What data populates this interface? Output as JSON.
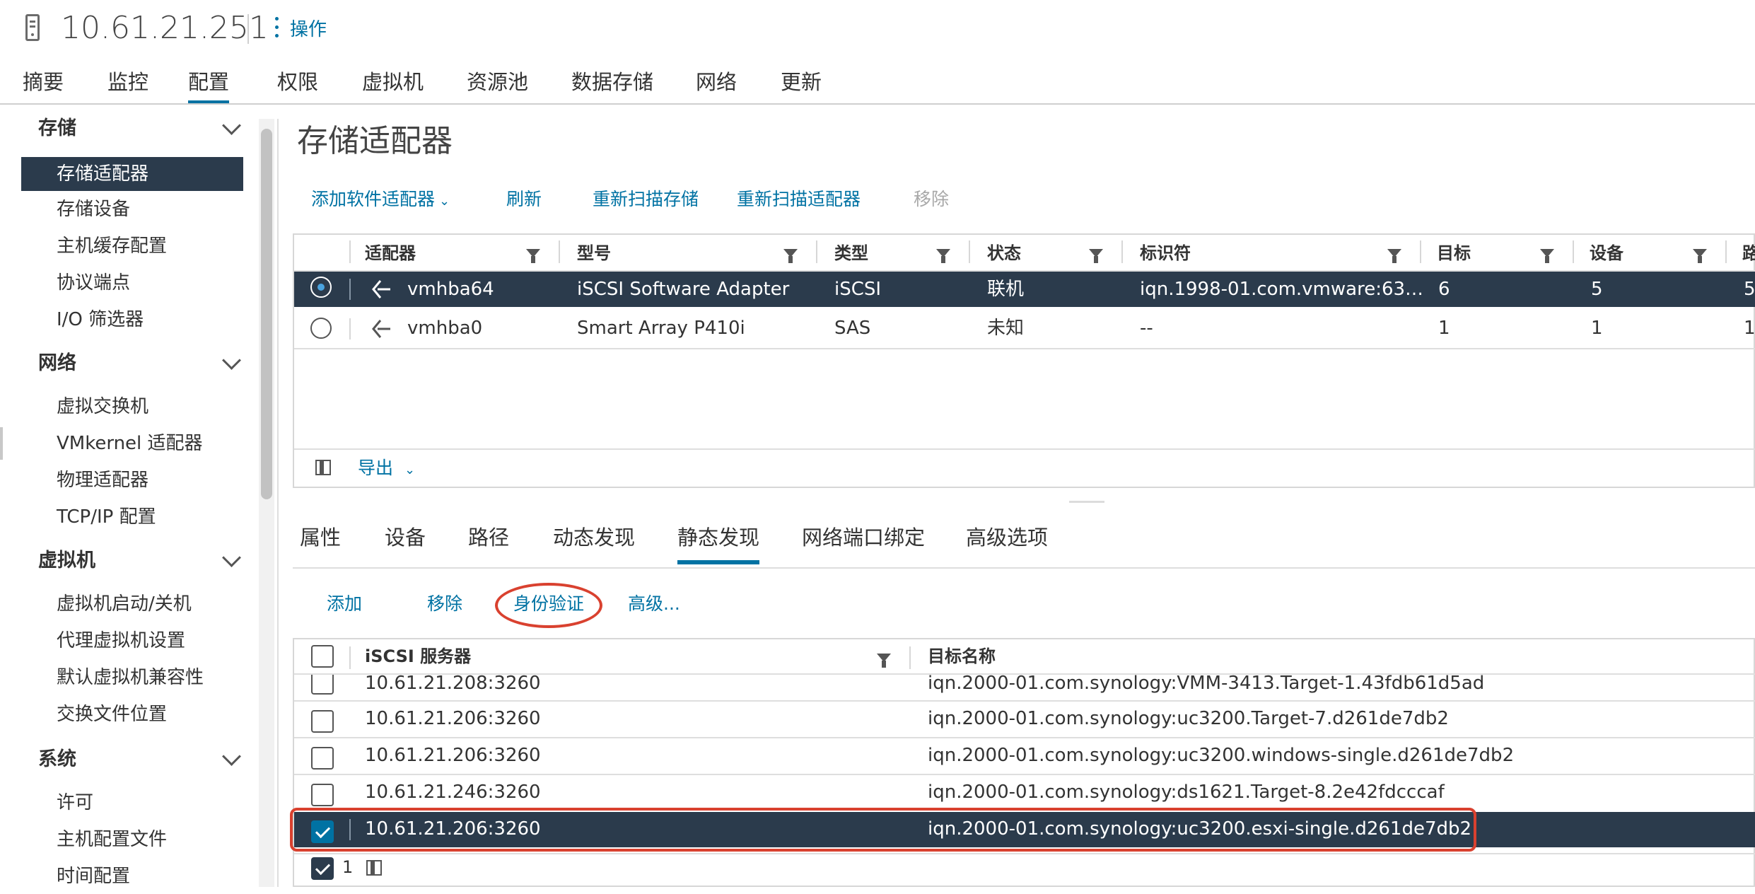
{
  "header": {
    "host": "10.61.21.251",
    "actions_label": "操作"
  },
  "top_tabs": [
    "摘要",
    "监控",
    "配置",
    "权限",
    "虚拟机",
    "资源池",
    "数据存储",
    "网络",
    "更新"
  ],
  "active_top_tab": "配置",
  "sidebar": {
    "sections": [
      {
        "title": "存储",
        "items": [
          "存储适配器",
          "存储设备",
          "主机缓存配置",
          "协议端点",
          "I/O 筛选器"
        ]
      },
      {
        "title": "网络",
        "items": [
          "虚拟交换机",
          "VMkernel 适配器",
          "物理适配器",
          "TCP/IP 配置"
        ]
      },
      {
        "title": "虚拟机",
        "items": [
          "虚拟机启动/关机",
          "代理虚拟机设置",
          "默认虚拟机兼容性",
          "交换文件位置"
        ]
      },
      {
        "title": "系统",
        "items": [
          "许可",
          "主机配置文件",
          "时间配置"
        ]
      }
    ],
    "active_item": "存储适配器"
  },
  "main": {
    "title": "存储适配器",
    "toolbar": {
      "add_software_adapter": "添加软件适配器",
      "refresh": "刷新",
      "rescan_storage": "重新扫描存储",
      "rescan_adapter": "重新扫描适配器",
      "remove": "移除"
    },
    "adapter_table": {
      "columns": [
        "适配器",
        "型号",
        "类型",
        "状态",
        "标识符",
        "目标",
        "设备",
        "路"
      ],
      "rows": [
        {
          "selected": true,
          "adapter": "vmhba64",
          "model": "iSCSI Software Adapter",
          "type": "iSCSI",
          "status": "联机",
          "identifier": "iqn.1998-01.com.vmware:63…",
          "targets": "6",
          "devices": "5",
          "paths": "5"
        },
        {
          "selected": false,
          "adapter": "vmhba0",
          "model": "Smart Array P410i",
          "type": "SAS",
          "status": "未知",
          "identifier": "--",
          "targets": "1",
          "devices": "1",
          "paths": "1"
        }
      ],
      "footer_export": "导出"
    },
    "detail_tabs": [
      "属性",
      "设备",
      "路径",
      "动态发现",
      "静态发现",
      "网络端口绑定",
      "高级选项"
    ],
    "active_detail_tab": "静态发现",
    "detail_toolbar": {
      "add": "添加",
      "remove": "移除",
      "auth": "身份验证",
      "advanced": "高级..."
    },
    "static_table": {
      "columns": [
        "iSCSI 服务器",
        "目标名称"
      ],
      "rows": [
        {
          "checked": false,
          "server": "10.61.21.208:3260",
          "target": "iqn.2000-01.com.synology:VMM-3413.Target-1.43fdb61d5ad"
        },
        {
          "checked": false,
          "server": "10.61.21.206:3260",
          "target": "iqn.2000-01.com.synology:uc3200.Target-7.d261de7db2"
        },
        {
          "checked": false,
          "server": "10.61.21.206:3260",
          "target": "iqn.2000-01.com.synology:uc3200.windows-single.d261de7db2"
        },
        {
          "checked": false,
          "server": "10.61.21.246:3260",
          "target": "iqn.2000-01.com.synology:ds1621.Target-8.2e42fdcccaf"
        },
        {
          "checked": true,
          "server": "10.61.21.206:3260",
          "target": "iqn.2000-01.com.synology:uc3200.esxi-single.d261de7db2"
        }
      ],
      "footer_count": "1"
    }
  },
  "colors": {
    "accent": "#0072a3",
    "selected_row": "#2b3b4c",
    "highlight_annotation": "#d9412f"
  }
}
